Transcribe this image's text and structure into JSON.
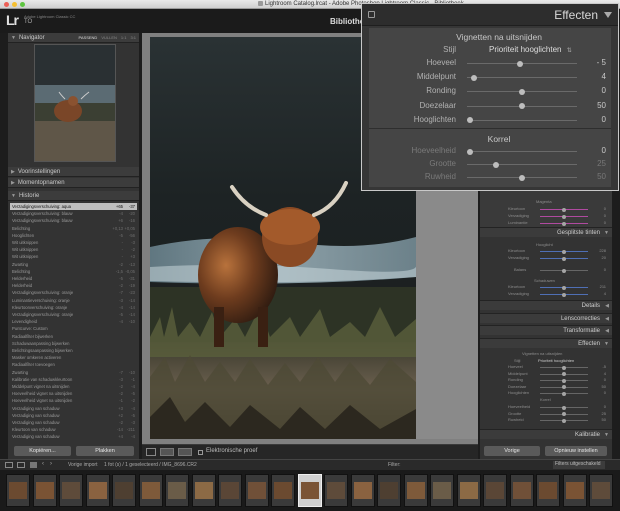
{
  "window": {
    "title": "Lightroom Catalog.lrcat - Adobe Photoshop Lightroom Classic - Bibliotheek"
  },
  "identity": {
    "logo": "Lr",
    "app_name": "Adobe Lightroom Classic CC",
    "user": "TO",
    "module": "Bibliotheek"
  },
  "left_panel": {
    "navigator": {
      "label": "Navigator",
      "zoom_opts": [
        "PASSEND",
        "VULLEN",
        "1:1",
        "3:1"
      ]
    },
    "presets_label": "Voorinstellingen",
    "snapshots_label": "Momentopnamen",
    "history_label": "Historie",
    "history": [
      {
        "name": "Verzadigingsverschuiving: aqua",
        "v1": "+65",
        "v2": "-37"
      },
      {
        "name": "Verzadigingsverschuiving: blauw",
        "v1": "-4",
        "v2": "-20"
      },
      {
        "name": "Verzadigingsverschuiving: blauw",
        "v1": "+6",
        "v2": "-16"
      },
      {
        "name": "Belichting",
        "v1": "+0,13",
        "v2": "+0,05"
      },
      {
        "name": "Hooglichten",
        "v1": "-5",
        "v2": "-56"
      },
      {
        "name": "Wit uitknippen",
        "v1": "-",
        "v2": "-3"
      },
      {
        "name": "Wit uitknippen",
        "v1": "-",
        "v2": "-2"
      },
      {
        "name": "Wit uitknippen",
        "v1": "-",
        "v2": "+3"
      },
      {
        "name": "Zwarting",
        "v1": "-2",
        "v2": "-13"
      },
      {
        "name": "Belichting",
        "v1": "-1,5",
        "v2": "-0,05"
      },
      {
        "name": "Helderheid",
        "v1": "-5",
        "v2": "-31"
      },
      {
        "name": "Helderheid",
        "v1": "-2",
        "v2": "-19"
      },
      {
        "name": "Verzadigingsverschuiving: oranje",
        "v1": "-7",
        "v2": "-23"
      },
      {
        "name": "Luminantieverschuiving: oranje",
        "v1": "-3",
        "v2": "-14"
      },
      {
        "name": "Kleurtoonverschuiving: oranje",
        "v1": "-4",
        "v2": "-14"
      },
      {
        "name": "Verzadigingsverschuiving: oranje",
        "v1": "-5",
        "v2": "-14"
      },
      {
        "name": "Levendigheid",
        "v1": "-4",
        "v2": "-10"
      },
      {
        "name": "Puntcurve: Custom",
        "v1": "",
        "v2": ""
      },
      {
        "name": "Radiaalfilter bijwerken",
        "v1": "",
        "v2": ""
      },
      {
        "name": "Schaduwaanpassing bijwerken",
        "v1": "",
        "v2": ""
      },
      {
        "name": "Belichtingsaanpassing bijwerken",
        "v1": "",
        "v2": ""
      },
      {
        "name": "Masker omkeren activeren",
        "v1": "",
        "v2": ""
      },
      {
        "name": "Radiaalfilter toevoegen",
        "v1": "",
        "v2": ""
      },
      {
        "name": "Zwarting",
        "v1": "-7",
        "v2": "-10"
      },
      {
        "name": "Kalibratie van schaduwkleurtoon",
        "v1": "-3",
        "v2": "-1"
      },
      {
        "name": "Middelpunt vignet na uitsnijden",
        "v1": "-2",
        "v2": "-4"
      },
      {
        "name": "Hoeveelheid vignet na uitsnijden",
        "v1": "-2",
        "v2": "-5"
      },
      {
        "name": "Hoeveelheid vignet na uitsnijden",
        "v1": "-1",
        "v2": "-2"
      },
      {
        "name": "Verzadiging van schaduw",
        "v1": "+3",
        "v2": "-4"
      },
      {
        "name": "Verzadiging van schaduw",
        "v1": "+2",
        "v2": "-5"
      },
      {
        "name": "Verzadiging van schaduw",
        "v1": "-2",
        "v2": "-3"
      },
      {
        "name": "Kleurtoon van schaduw",
        "v1": "-14",
        "v2": "-211"
      },
      {
        "name": "Verzadiging van schaduw",
        "v1": "+4",
        "v2": "-4"
      }
    ],
    "copy_label": "Kopiëren...",
    "paste_label": "Plakken"
  },
  "center": {
    "toolbar_label": "Elektronische proef"
  },
  "right_panel": {
    "magenta_label": "Magenta",
    "magenta_rows": [
      {
        "label": "Kleurtoon",
        "value": "0"
      },
      {
        "label": "Verzadiging",
        "value": "0"
      },
      {
        "label": "Luminantie",
        "value": "0"
      }
    ],
    "split_toning_label": "Gesplitste tinten",
    "highlights_label": "Hooglicht",
    "split_high": [
      {
        "label": "Kleurtoon",
        "value": "228"
      },
      {
        "label": "Verzadiging",
        "value": "20"
      }
    ],
    "balance_label": "Balans",
    "balance_value": "0",
    "shadows_label": "Schaduwen",
    "split_shadow": [
      {
        "label": "Kleurtoon",
        "value": "211"
      },
      {
        "label": "Verzadiging",
        "value": "4"
      }
    ],
    "details_label": "Details",
    "lens_label": "Lenscorrecties",
    "transform_label": "Transformatie",
    "effects_label": "Effecten",
    "vignet_label": "Vignetten na uitsnijden",
    "style_label": "Stijl",
    "style_value": "Prioriteit hooglichten",
    "vignet_rows": [
      {
        "label": "Hoeveel",
        "value": "-5"
      },
      {
        "label": "Middelpunt",
        "value": "4"
      },
      {
        "label": "Ronding",
        "value": "0"
      },
      {
        "label": "Doezelaar",
        "value": "50"
      },
      {
        "label": "Hooglichten",
        "value": "0"
      }
    ],
    "grain_label": "Korrel",
    "grain_rows": [
      {
        "label": "Hoeveelheid",
        "value": "0"
      },
      {
        "label": "Grootte",
        "value": "25"
      },
      {
        "label": "Ruwheid",
        "value": "50"
      }
    ],
    "calibration_label": "Kalibratie",
    "prev_button": "Vorige",
    "reset_button": "Opnieuw instellen"
  },
  "overlay": {
    "title": "Effecten",
    "vignet_section": "Vignetten na uitsnijden",
    "style_label": "Stijl",
    "style_value": "Prioriteit hooglichten",
    "rows": [
      {
        "label": "Hoeveel",
        "value": "- 5",
        "pos": 0.48
      },
      {
        "label": "Middelpunt",
        "value": "4",
        "pos": 0.04
      },
      {
        "label": "Ronding",
        "value": "0",
        "pos": 0.5
      },
      {
        "label": "Doezelaar",
        "value": "50",
        "pos": 0.5
      },
      {
        "label": "Hooglichten",
        "value": "0",
        "pos": 0.0
      }
    ],
    "grain_section": "Korrel",
    "grain_rows": [
      {
        "label": "Hoeveelheid",
        "value": "0",
        "pos": 0.0
      },
      {
        "label": "Grootte",
        "value": "25",
        "pos": 0.25
      },
      {
        "label": "Ruwheid",
        "value": "50",
        "pos": 0.5
      }
    ]
  },
  "filmstrip": {
    "prev_import": "Vorige import",
    "info": "1 fot (s) / 1 geselecteerd / IMG_8696.CR2",
    "filter_label": "Filter:",
    "filter_value": "Filters uitgeschakeld"
  },
  "colors": {
    "accent_magenta": "#b04aa0",
    "accent_blue": "#4f6fb5"
  }
}
